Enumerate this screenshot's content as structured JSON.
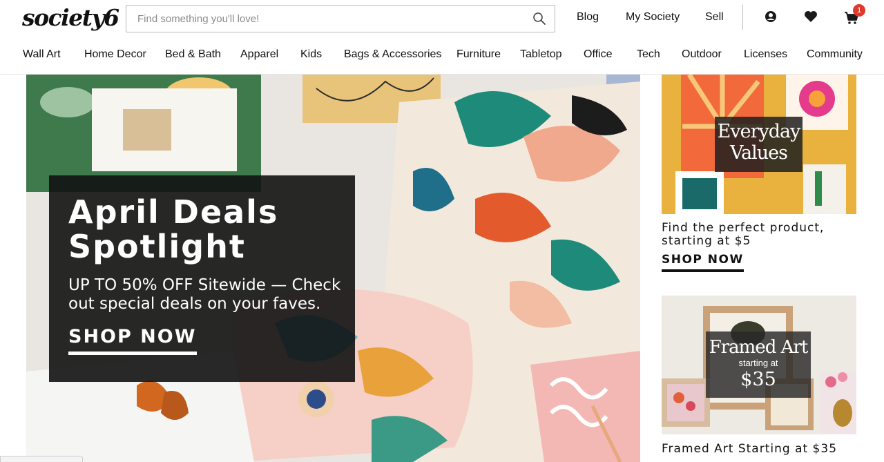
{
  "brand": {
    "logo": "society6"
  },
  "search": {
    "placeholder": "Find something you'll love!",
    "value": ""
  },
  "header_links": {
    "blog": "Blog",
    "my_society": "My Society",
    "sell": "Sell"
  },
  "cart": {
    "count": "1"
  },
  "icons": {
    "search": "search-icon",
    "account": "account-icon",
    "wishlist": "heart-icon",
    "cart": "cart-icon"
  },
  "nav": {
    "items": [
      "Wall Art",
      "Home Decor",
      "Bed & Bath",
      "Apparel",
      "Kids",
      "Bags & Accessories",
      "Furniture",
      "Tabletop",
      "Office",
      "Tech",
      "Outdoor",
      "Licenses",
      "Community"
    ]
  },
  "hero": {
    "title_line1": "April Deals",
    "title_line2": "Spotlight",
    "subtitle": "UP TO 50% OFF Sitewide — Check out special deals on your faves.",
    "cta": "SHOP NOW"
  },
  "card_everyday": {
    "overlay_line1": "Everyday",
    "overlay_line2": "Values",
    "text": "Find the perfect product, starting at $5",
    "cta": "SHOP NOW"
  },
  "card_framed": {
    "overlay_line1": "Framed Art",
    "overlay_line2": "starting at",
    "overlay_line3": "$35",
    "text": "Framed Art Starting at $35"
  },
  "colors": {
    "badge": "#e0392b",
    "promo_bg": "#121212",
    "accent_orange": "#e8b23a"
  }
}
